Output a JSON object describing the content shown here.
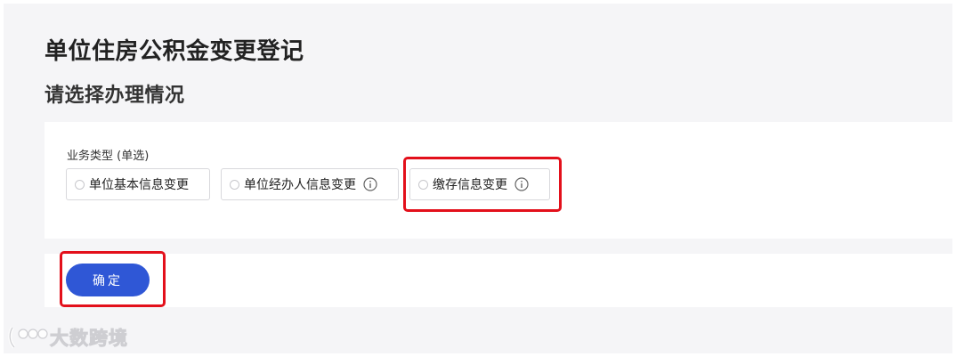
{
  "page": {
    "title": "单位住房公积金变更登记",
    "subtitle": "请选择办理情况"
  },
  "form": {
    "field_label": "业务类型 (单选)",
    "options": [
      {
        "label": "单位基本信息变更",
        "selected": false,
        "has_info_icon": false
      },
      {
        "label": "单位经办人信息变更",
        "selected": false,
        "has_info_icon": true
      },
      {
        "label": "缴存信息变更",
        "selected": false,
        "has_info_icon": true
      }
    ]
  },
  "actions": {
    "confirm_label": "确定"
  },
  "watermark": {
    "text": "大数跨境"
  },
  "colors": {
    "background": "#f5f5f7",
    "primary_button": "#2f57d6",
    "highlight_box": "#e3101b"
  }
}
